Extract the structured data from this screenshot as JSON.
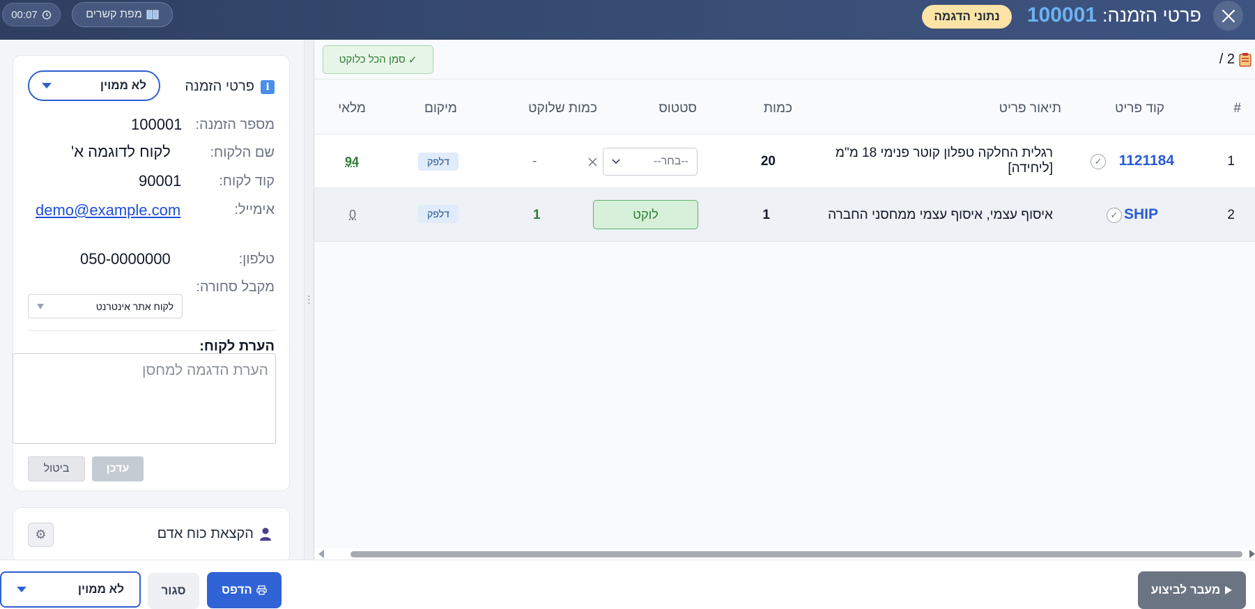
{
  "header": {
    "title_prefix": "פרטי הזמנה:",
    "order_number": "100001",
    "badge": "נתוני הדגמה",
    "map_label": "מפת קשרים",
    "timer": "00:07"
  },
  "order_panel": {
    "section_title": "פרטי הזמנה",
    "sort_select": "לא ממוין",
    "fields": {
      "order_number_label": "מספר הזמנה:",
      "order_number_value": "100001",
      "customer_name_label": "שם הלקוח:",
      "customer_name_value": "לקוח לדוגמה א'",
      "customer_code_label": "קוד לקוח:",
      "customer_code_value": "90001",
      "email_label": "אימייל:",
      "email_value": "demo@example.com",
      "phone_label": "טלפון:",
      "phone_value": "050-0000000",
      "receiver_label": "מקבל סחורה:",
      "receiver_value": "לקוח אתר אינטרנט"
    },
    "note_title": "הערת לקוח:",
    "note_value": "הערת הדגמה למחסן",
    "save_label": "עדכן",
    "cancel_label": "ביטול"
  },
  "staff_panel": {
    "title": "הקצאת כוח אדם"
  },
  "toolbar": {
    "mark_all_label": "סמן הכל כלוקט",
    "page_count": "2 /"
  },
  "table": {
    "headers": {
      "index": "#",
      "code": "קוד פריט",
      "description": "תיאור פריט",
      "quantity": "כמות",
      "status": "סטטוס",
      "picked_qty": "כמות שלוקט",
      "location": "מיקום",
      "stock": "מלאי"
    },
    "rows": [
      {
        "index": "1",
        "code": "1121184",
        "description_line1": "רגלית החלקה טפלון קוטר פנימי 18 מ\"מ",
        "description_line2": "[ליחידה]",
        "quantity": "20",
        "status_placeholder": "--בחר--",
        "picked_qty": "-",
        "location": "דלפק",
        "stock": "94"
      },
      {
        "index": "2",
        "code": "SHIP",
        "description_line1": "איסוף עצמי, איסוף עצמי ממחסני החברה",
        "quantity": "1",
        "status_value": "לוקט",
        "picked_qty": "1",
        "location": "דלפק",
        "stock": "0"
      }
    ]
  },
  "footer": {
    "sort_select": "לא ממוין",
    "close_label": "סגור",
    "print_label": "הדפס",
    "exec_label": "מעבר לביצוע"
  },
  "colors": {
    "header_bg": "#34466b",
    "accent_blue": "#2f63d6",
    "order_number": "#6cb2f2",
    "picked_green": "#2e7d32",
    "badge_yellow": "#fde4a6"
  },
  "icons": {
    "close": "close-icon",
    "info": "info-icon",
    "book": "book-icon",
    "clock": "clock-icon",
    "clipboard": "clipboard-icon",
    "person": "person-icon",
    "gear": "gear-icon",
    "printer": "printer-icon",
    "play": "play-icon"
  }
}
